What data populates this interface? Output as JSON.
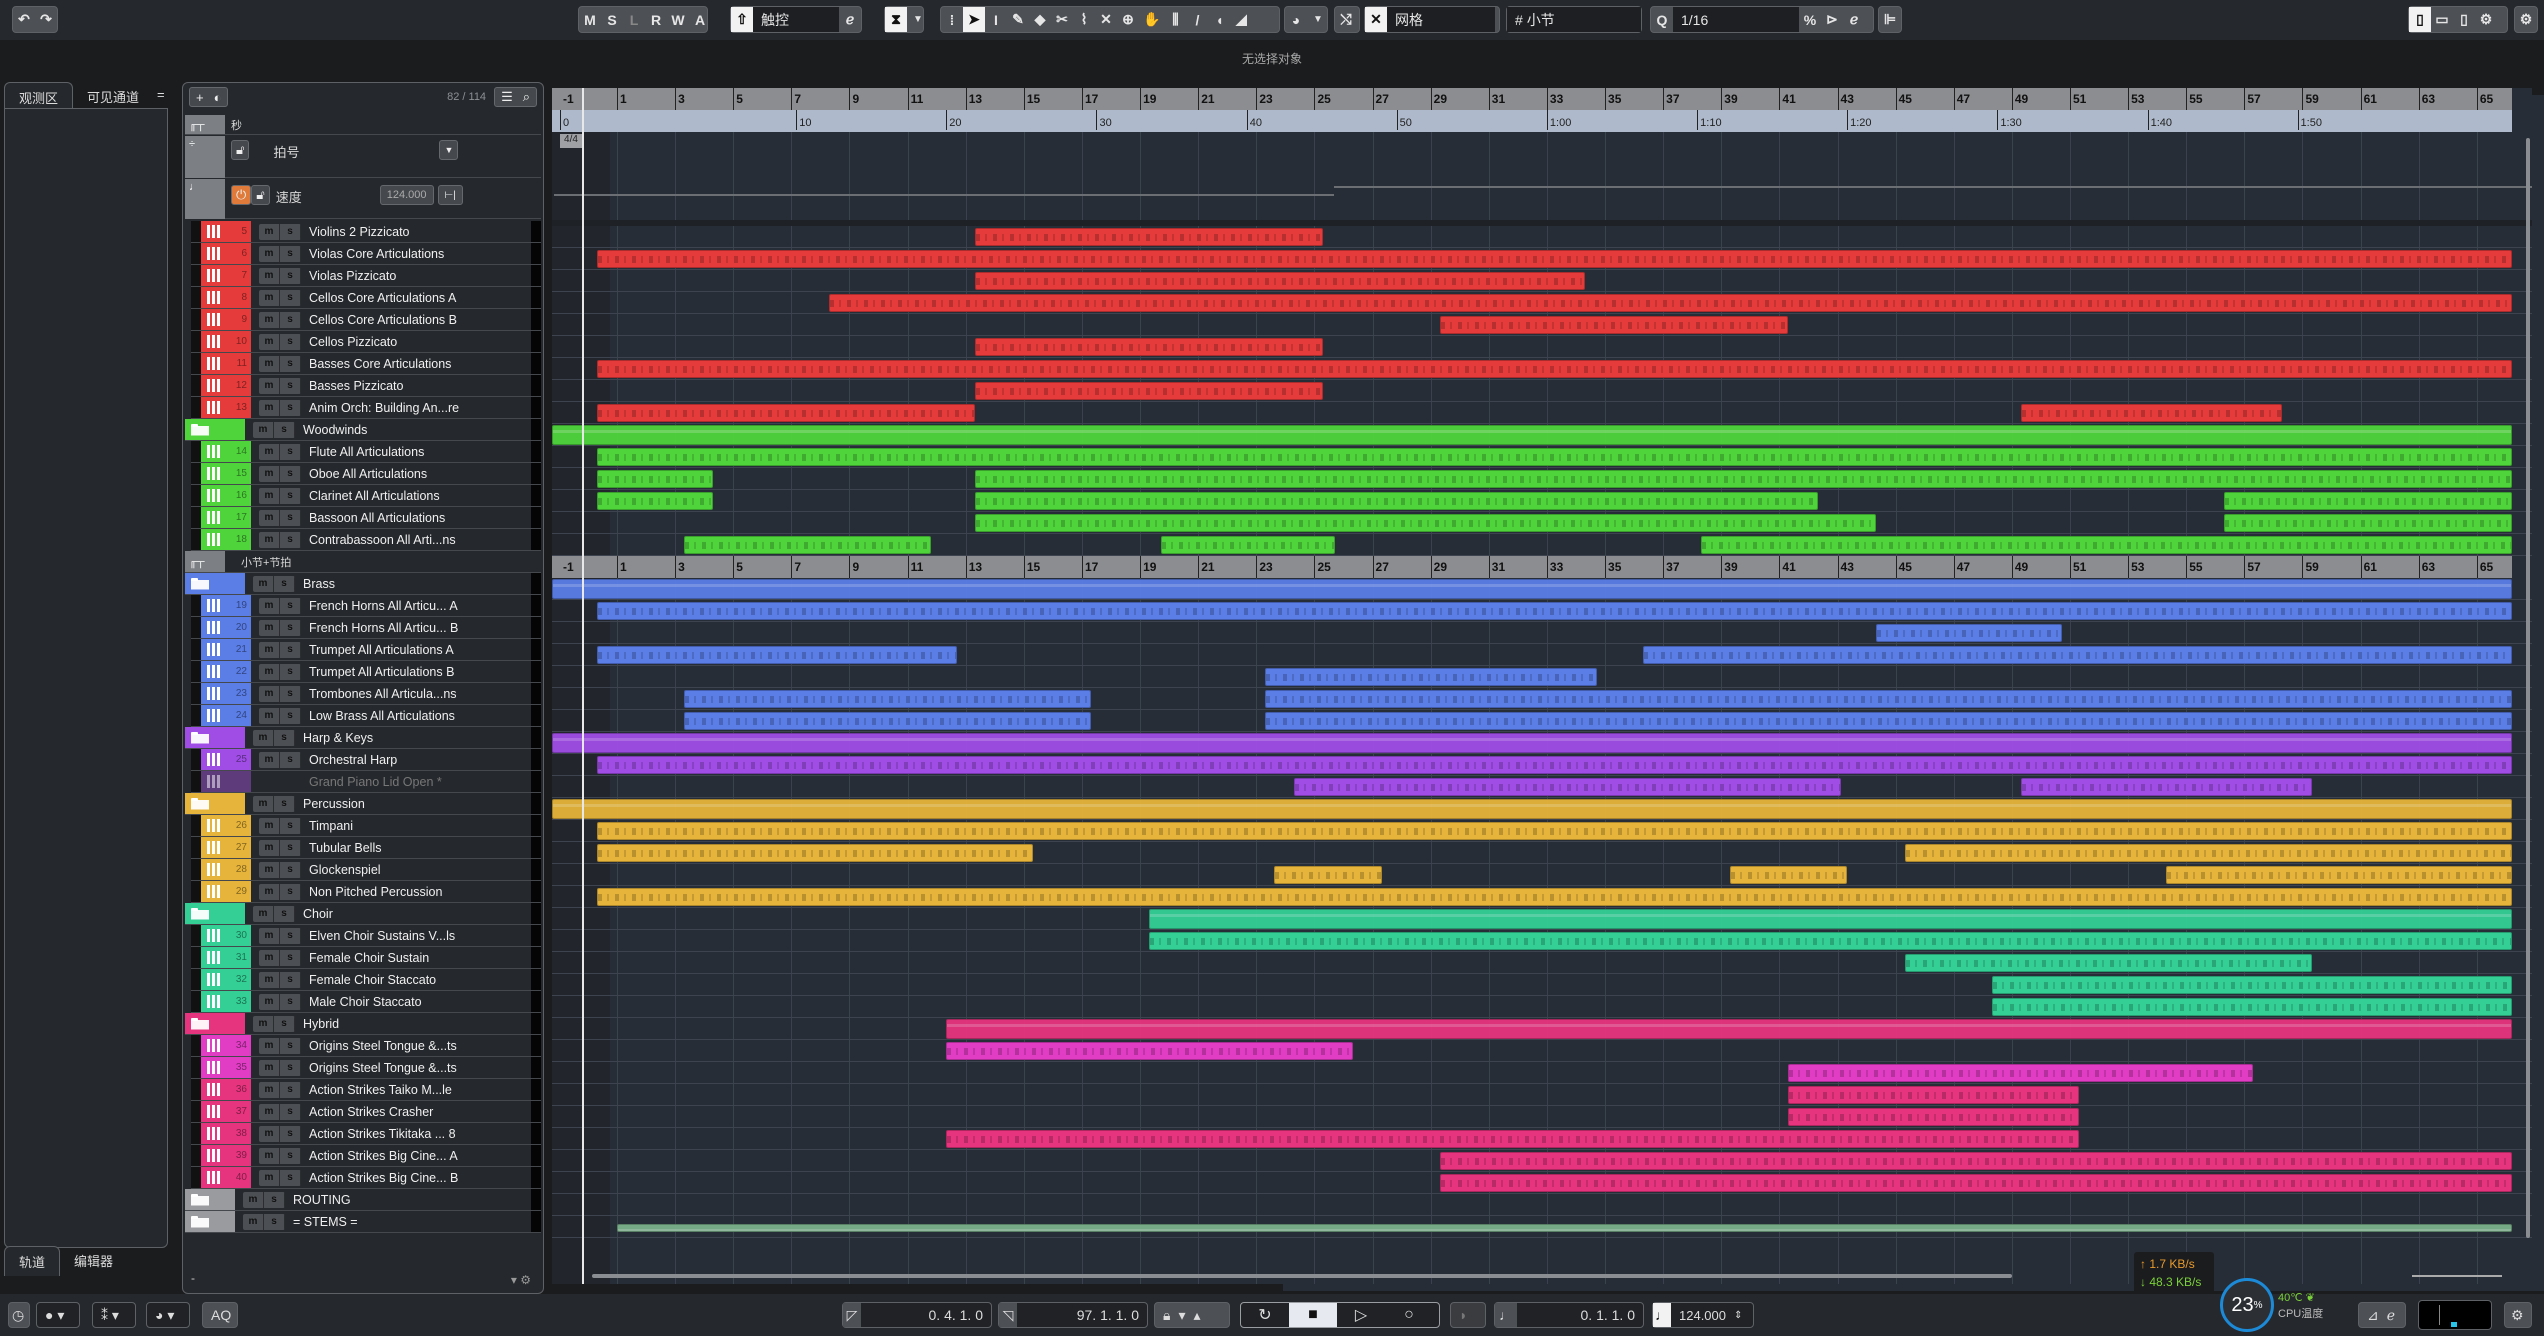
{
  "toolbar": {
    "undo_icon": "undo-icon",
    "redo_icon": "redo-icon",
    "automation_buttons": [
      "M",
      "S",
      "L",
      "R",
      "W",
      "A"
    ],
    "automation_mode": "触控",
    "tools": [
      "select-icon",
      "range-icon",
      "draw-icon",
      "erase-icon",
      "split-icon",
      "glue-icon",
      "mute-icon",
      "zoom-icon",
      "hand-icon",
      "comp-icon",
      "line-icon",
      "play-icon",
      "color-icon"
    ],
    "snap_type": "网格",
    "grid_type": "小节",
    "grid_type_symbol": "#",
    "quantize_label": "Q",
    "quantize_value": "1/16"
  },
  "status_line": "无选择对象",
  "left_zone": {
    "tabs": [
      "观测区",
      "可见通道"
    ],
    "menu_icon": "=",
    "bottom_tabs": [
      "轨道",
      "编辑器"
    ]
  },
  "track_list": {
    "count": "82 / 114",
    "ruler_label": "秒",
    "signature_label": "拍号",
    "tempo_label": "速度",
    "tempo_value": "124.000",
    "ruler2_label": "小节+节拍",
    "footer_text": "-",
    "tracks": [
      {
        "num": "5",
        "name": "Violins 2 Pizzicato",
        "color": "#e53b3b",
        "type": "midi"
      },
      {
        "num": "6",
        "name": "Violas Core Articulations",
        "color": "#e53b3b",
        "type": "midi"
      },
      {
        "num": "7",
        "name": "Violas Pizzicato",
        "color": "#e53b3b",
        "type": "midi"
      },
      {
        "num": "8",
        "name": "Cellos Core Articulations A",
        "color": "#e53b3b",
        "type": "midi"
      },
      {
        "num": "9",
        "name": "Cellos Core Articulations B",
        "color": "#e53b3b",
        "type": "midi"
      },
      {
        "num": "10",
        "name": "Cellos Pizzicato",
        "color": "#e53b3b",
        "type": "midi"
      },
      {
        "num": "11",
        "name": "Basses Core Articulations",
        "color": "#e53b3b",
        "type": "midi"
      },
      {
        "num": "12",
        "name": "Basses Pizzicato",
        "color": "#e53b3b",
        "type": "midi"
      },
      {
        "num": "13",
        "name": "Anim Orch: Building An...re",
        "color": "#e53b3b",
        "type": "midi"
      },
      {
        "num": "",
        "name": "Woodwinds",
        "color": "#4fd43c",
        "type": "folder"
      },
      {
        "num": "14",
        "name": "Flute All Articulations",
        "color": "#4fd43c",
        "type": "midi"
      },
      {
        "num": "15",
        "name": "Oboe All Articulations",
        "color": "#4fd43c",
        "type": "midi"
      },
      {
        "num": "16",
        "name": "Clarinet All Articulations",
        "color": "#4fd43c",
        "type": "midi"
      },
      {
        "num": "17",
        "name": "Bassoon All Articulations",
        "color": "#4fd43c",
        "type": "midi"
      },
      {
        "num": "18",
        "name": "Contrabassoon All Arti...ns",
        "color": "#4fd43c",
        "type": "midi"
      },
      {
        "num": "",
        "name": "小节+节拍",
        "color": "#7c7f83",
        "type": "ruler"
      },
      {
        "num": "",
        "name": "Brass",
        "color": "#5a7de6",
        "type": "folder"
      },
      {
        "num": "19",
        "name": "French Horns All Articu... A",
        "color": "#5a7de6",
        "type": "midi"
      },
      {
        "num": "20",
        "name": "French Horns All Articu... B",
        "color": "#5a7de6",
        "type": "midi"
      },
      {
        "num": "21",
        "name": "Trumpet All Articulations A",
        "color": "#5a7de6",
        "type": "midi"
      },
      {
        "num": "22",
        "name": "Trumpet All Articulations B",
        "color": "#5a7de6",
        "type": "midi"
      },
      {
        "num": "23",
        "name": "Trombones All Articula...ns",
        "color": "#5a7de6",
        "type": "midi"
      },
      {
        "num": "24",
        "name": "Low Brass All Articulations",
        "color": "#5a7de6",
        "type": "midi"
      },
      {
        "num": "",
        "name": "Harp & Keys",
        "color": "#a04de6",
        "type": "folder"
      },
      {
        "num": "25",
        "name": "Orchestral Harp",
        "color": "#a04de6",
        "type": "midi"
      },
      {
        "num": "",
        "name": "Grand Piano Lid Open *",
        "color": "#5e3b7a",
        "type": "disabled"
      },
      {
        "num": "",
        "name": "Percussion",
        "color": "#e6b43a",
        "type": "folder"
      },
      {
        "num": "26",
        "name": "Timpani",
        "color": "#e6b43a",
        "type": "midi"
      },
      {
        "num": "27",
        "name": "Tubular Bells",
        "color": "#e6b43a",
        "type": "midi"
      },
      {
        "num": "28",
        "name": "Glockenspiel",
        "color": "#e6b43a",
        "type": "midi"
      },
      {
        "num": "29",
        "name": "Non Pitched Percussion",
        "color": "#e6b43a",
        "type": "midi"
      },
      {
        "num": "",
        "name": "Choir",
        "color": "#33cf95",
        "type": "folder"
      },
      {
        "num": "30",
        "name": "Elven Choir Sustains V...ls",
        "color": "#33cf95",
        "type": "midi"
      },
      {
        "num": "31",
        "name": "Female Choir Sustain",
        "color": "#33cf95",
        "type": "midi"
      },
      {
        "num": "32",
        "name": "Female Choir Staccato",
        "color": "#33cf95",
        "type": "midi"
      },
      {
        "num": "33",
        "name": "Male Choir Staccato",
        "color": "#33cf95",
        "type": "midi"
      },
      {
        "num": "",
        "name": "Hybrid",
        "color": "#e6347e",
        "type": "folder"
      },
      {
        "num": "34",
        "name": "Origins Steel Tongue &...ts",
        "color": "#e03cc4",
        "type": "midi"
      },
      {
        "num": "35",
        "name": "Origins Steel Tongue &...ts",
        "color": "#e03cc4",
        "type": "midi"
      },
      {
        "num": "36",
        "name": "Action Strikes Taiko M...le",
        "color": "#e6347e",
        "type": "midi"
      },
      {
        "num": "37",
        "name": "Action Strikes Crasher",
        "color": "#e6347e",
        "type": "midi"
      },
      {
        "num": "38",
        "name": "Action Strikes Tikitaka ... 8",
        "color": "#e6347e",
        "type": "midi"
      },
      {
        "num": "39",
        "name": "Action Strikes Big Cine... A",
        "color": "#e6347e",
        "type": "midi"
      },
      {
        "num": "40",
        "name": "Action Strikes Big Cine... B",
        "color": "#e6347e",
        "type": "midi"
      },
      {
        "num": "",
        "name": "ROUTING",
        "color": "#9a9b9e",
        "type": "folder-gray"
      },
      {
        "num": "",
        "name": "= STEMS =",
        "color": "#9a9b9e",
        "type": "folder-gray"
      }
    ]
  },
  "arrangement": {
    "bar_labels": [
      "-1",
      "1",
      "3",
      "5",
      "7",
      "9",
      "11",
      "13",
      "15",
      "17",
      "19",
      "21",
      "23",
      "25",
      "27",
      "29",
      "31",
      "33",
      "35",
      "37",
      "39",
      "41",
      "43",
      "45",
      "47",
      "49",
      "51",
      "53",
      "55",
      "57",
      "59",
      "61",
      "63",
      "65"
    ],
    "time_labels": [
      {
        "t": "0",
        "bar": 0.0
      },
      {
        "t": "10",
        "bar": 6.17
      },
      {
        "t": "20",
        "bar": 11.33
      },
      {
        "t": "30",
        "bar": 16.5
      },
      {
        "t": "40",
        "bar": 21.67
      },
      {
        "t": "50",
        "bar": 26.83
      },
      {
        "t": "1:00",
        "bar": 32.0
      },
      {
        "t": "1:10",
        "bar": 37.17
      },
      {
        "t": "1:20",
        "bar": 42.33
      },
      {
        "t": "1:30",
        "bar": 47.5
      },
      {
        "t": "1:40",
        "bar": 52.67
      },
      {
        "t": "1:50",
        "bar": 57.83
      }
    ],
    "time_signature": "4/4",
    "events": [
      [
        [
          13,
          25
        ]
      ],
      [
        [
          0,
          66
        ]
      ],
      [
        [
          13,
          34
        ]
      ],
      [
        [
          8,
          66
        ]
      ],
      [
        [
          29,
          41
        ]
      ],
      [
        [
          13,
          25
        ]
      ],
      [
        [
          0,
          66
        ]
      ],
      [
        [
          13,
          25
        ]
      ],
      [
        [
          0,
          13
        ],
        [
          49,
          58
        ]
      ],
      [
        [
          -1,
          66
        ]
      ],
      [
        [
          0,
          66
        ]
      ],
      [
        [
          0,
          4
        ],
        [
          13,
          66
        ]
      ],
      [
        [
          0,
          4
        ],
        [
          13,
          42
        ],
        [
          56,
          66
        ]
      ],
      [
        [
          13,
          44
        ],
        [
          56,
          66
        ]
      ],
      [
        [
          3,
          11.5
        ],
        [
          19.4,
          25.4
        ],
        [
          38,
          66
        ]
      ],
      [],
      [
        [
          -1,
          66
        ]
      ],
      [
        [
          0,
          66
        ]
      ],
      [
        [
          44,
          50.4
        ]
      ],
      [
        [
          0,
          12.4
        ],
        [
          36,
          66
        ]
      ],
      [
        [
          23,
          34.4
        ]
      ],
      [
        [
          3,
          17
        ],
        [
          23,
          66
        ]
      ],
      [
        [
          3,
          17
        ],
        [
          23,
          66
        ]
      ],
      [
        [
          -1,
          66
        ]
      ],
      [
        [
          0,
          66
        ]
      ],
      [
        [
          24,
          42.8
        ],
        [
          49,
          59
        ]
      ],
      [
        [
          -1,
          66
        ]
      ],
      [
        [
          0,
          66
        ]
      ],
      [
        [
          0,
          15
        ],
        [
          45,
          66
        ]
      ],
      [
        [
          23.3,
          27
        ],
        [
          39,
          43
        ],
        [
          54,
          66
        ]
      ],
      [
        [
          0,
          66
        ]
      ],
      [
        [
          19,
          66
        ]
      ],
      [
        [
          19,
          66
        ]
      ],
      [
        [
          45,
          59
        ]
      ],
      [
        [
          48,
          66
        ]
      ],
      [
        [
          48,
          66
        ]
      ],
      [
        [
          12,
          66
        ]
      ],
      [
        [
          12,
          26
        ]
      ],
      [
        [
          41,
          57
        ]
      ],
      [
        [
          41,
          51
        ]
      ],
      [
        [
          41,
          51
        ]
      ],
      [
        [
          12,
          51
        ]
      ],
      [
        [
          29,
          66
        ]
      ],
      [
        [
          29,
          66
        ]
      ],
      [],
      [
        [
          0.7,
          66
        ]
      ]
    ]
  },
  "transport": {
    "left_locator": "0. 4. 1.   0",
    "right_locator": "97. 1. 1.   0",
    "position": "0. 1. 1.   0",
    "tempo": "124.000",
    "aq_label": "AQ",
    "buttons": [
      "cycle-icon",
      "stop-icon",
      "play-icon",
      "record-icon"
    ]
  },
  "system_monitor": {
    "upload": "↑ 1.7 KB/s",
    "download": "↓ 48.3 KB/s",
    "cpu_percent": "23",
    "cpu_unit": "%",
    "temperature": "40℃",
    "temp_label": "CPU温度",
    "upload_color": "#e89a2c",
    "download_color": "#7ad13a"
  },
  "window_layout_buttons": [
    "left-zone-icon",
    "lower-zone-icon",
    "right-zone-icon",
    "layout-settings-icon",
    "settings-icon"
  ]
}
